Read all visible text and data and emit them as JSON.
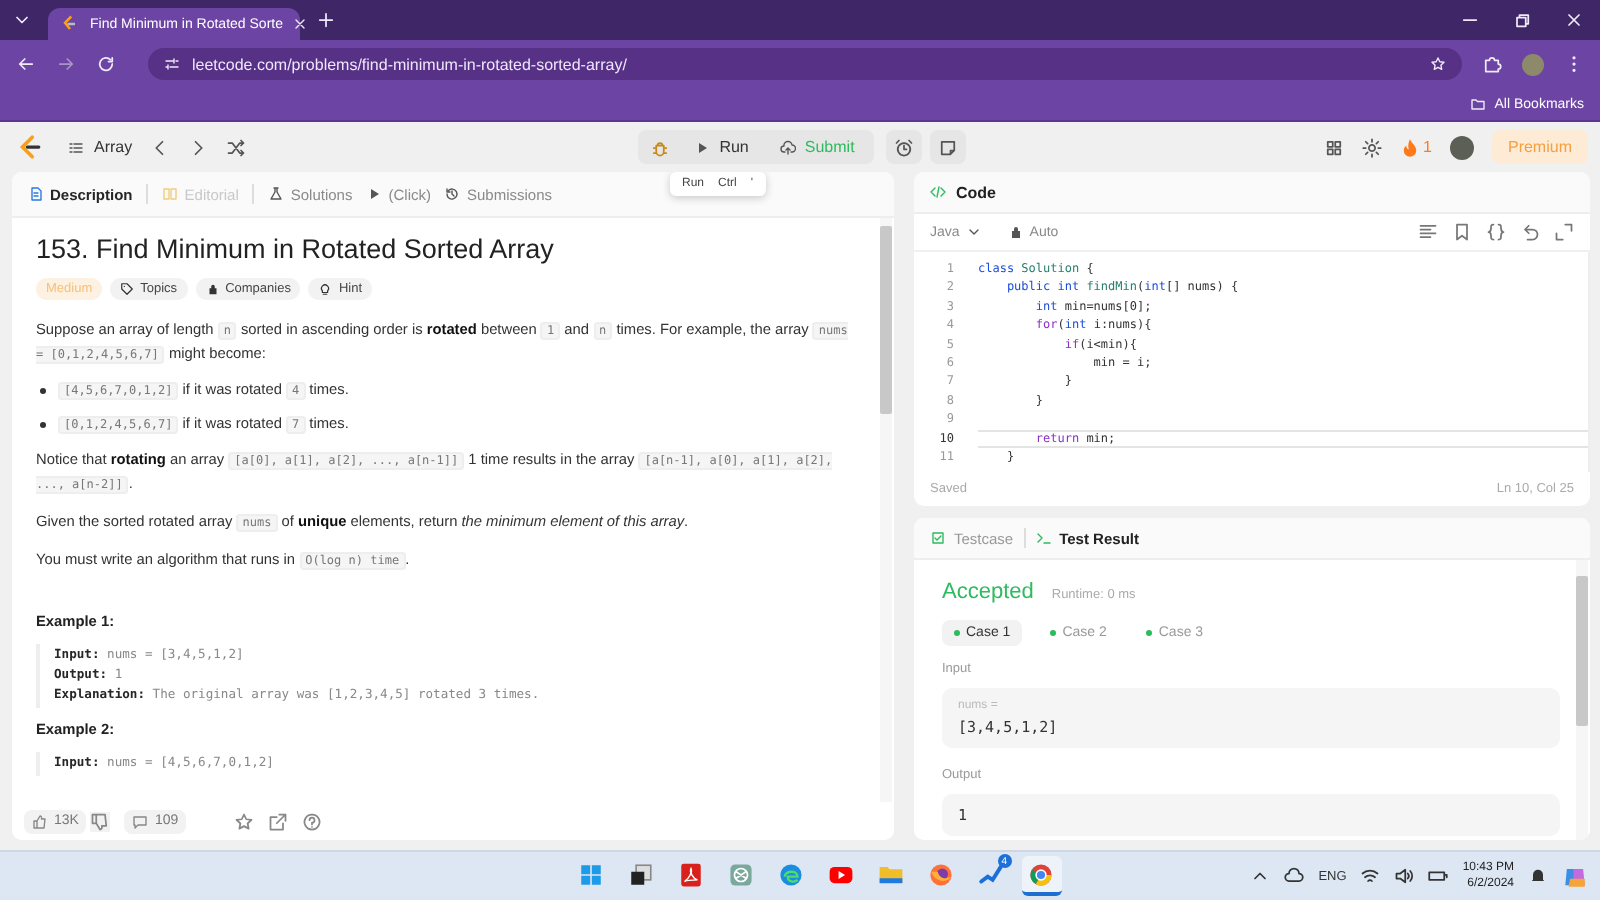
{
  "browser": {
    "tab_title": "Find Minimum in Rotated Sorte",
    "url": "leetcode.com/problems/find-minimum-in-rotated-sorted-array/",
    "bookmarks": "All Bookmarks"
  },
  "toolbar": {
    "problem_list": "Array",
    "run": "Run",
    "submit": "Submit",
    "streak": "1",
    "premium": "Premium"
  },
  "tooltip": {
    "label": "Run",
    "keys": [
      "Ctrl",
      "'"
    ]
  },
  "description_tabs": [
    {
      "label": "Description",
      "selected": true,
      "disabled": false
    },
    {
      "label": "Editorial",
      "selected": false,
      "disabled": true
    },
    {
      "label": "Solutions",
      "selected": false,
      "disabled": false
    },
    {
      "label": "(Click)",
      "selected": false,
      "disabled": false
    },
    {
      "label": "Submissions",
      "selected": false,
      "disabled": false
    }
  ],
  "problem": {
    "title": "153. Find Minimum in Rotated Sorted Array",
    "difficulty": "Medium",
    "tags": [
      "Topics",
      "Companies",
      "Hint"
    ],
    "blocks": [
      {
        "kind": "paragraph",
        "parts": [
          {
            "kind": "text",
            "text": "Suppose an array of length "
          },
          {
            "kind": "code",
            "text": "n"
          },
          {
            "kind": "text",
            "text": " sorted in ascending order is **rotated** between "
          },
          {
            "kind": "code",
            "text": "1"
          },
          {
            "kind": "text",
            "text": " and "
          },
          {
            "kind": "code",
            "text": "n"
          },
          {
            "kind": "text",
            "text": " times. For example, the array "
          },
          {
            "kind": "code",
            "text": "nums = [0,1,2,4,5,6,7]"
          },
          {
            "kind": "text",
            "text": " might become:"
          }
        ]
      },
      {
        "kind": "bullet",
        "parts": [
          {
            "kind": "code",
            "text": "[4,5,6,7,0,1,2]"
          },
          {
            "kind": "text",
            "text": " if it was rotated "
          },
          {
            "kind": "code",
            "text": "4"
          },
          {
            "kind": "text",
            "text": " times."
          }
        ]
      },
      {
        "kind": "bullet",
        "parts": [
          {
            "kind": "code",
            "text": "[0,1,2,4,5,6,7]"
          },
          {
            "kind": "text",
            "text": " if it was rotated "
          },
          {
            "kind": "code",
            "text": "7"
          },
          {
            "kind": "text",
            "text": " times."
          }
        ]
      },
      {
        "kind": "paragraph",
        "parts": [
          {
            "kind": "text",
            "text": "Notice that **rotating** an array "
          },
          {
            "kind": "code",
            "text": "[a[0], a[1], a[2], ..., a[n-1]]"
          },
          {
            "kind": "text",
            "text": " 1 time results in the array "
          },
          {
            "kind": "code",
            "text": "[a[n-1], a[0], a[1], a[2], ..., a[n-2]]"
          },
          {
            "kind": "text",
            "text": "."
          }
        ]
      },
      {
        "kind": "paragraph",
        "parts": [
          {
            "kind": "text",
            "text": "Given the sorted rotated array "
          },
          {
            "kind": "code",
            "text": "nums"
          },
          {
            "kind": "text",
            "text": " of **unique** elements, return *the minimum element of this array*."
          }
        ]
      },
      {
        "kind": "paragraph",
        "parts": [
          {
            "kind": "text",
            "text": "You must write an algorithm that runs in "
          },
          {
            "kind": "code",
            "text": "O(log n) time"
          },
          {
            "kind": "text",
            "text": "."
          }
        ]
      },
      {
        "kind": "heading",
        "text": "Example 1:"
      },
      {
        "kind": "example",
        "lines": [
          "**Input:** nums = [3,4,5,1,2]",
          "**Output:** 1",
          "**Explanation:** The original array was [1,2,3,4,5] rotated 3 times."
        ]
      },
      {
        "kind": "heading",
        "text": "Example 2:"
      },
      {
        "kind": "example",
        "lines": [
          "**Input:** nums = [4,5,6,7,0,1,2]"
        ]
      }
    ]
  },
  "footer": {
    "likes": "13K",
    "comments": "109"
  },
  "code": {
    "title": "Code",
    "language": "Java",
    "mode": "Auto",
    "status": "Saved",
    "cursor": "Ln 10, Col 25",
    "lines": [
      {
        "number": "1",
        "current": false,
        "tokens": [
          {
            "kind": "keyword",
            "text": "class"
          },
          {
            "kind": "name",
            "text": " Solution"
          },
          {
            "kind": "plain",
            "text": " {"
          }
        ]
      },
      {
        "number": "2",
        "current": false,
        "tokens": [
          {
            "kind": "keyword",
            "text": "    public int"
          },
          {
            "kind": "name",
            "text": " findMin"
          },
          {
            "kind": "plain",
            "text": "("
          },
          {
            "kind": "keyword",
            "text": "int"
          },
          {
            "kind": "plain",
            "text": "[] nums) {"
          }
        ]
      },
      {
        "number": "3",
        "current": false,
        "tokens": [
          {
            "kind": "keyword",
            "text": "        int"
          },
          {
            "kind": "plain",
            "text": " min=nums[0];"
          }
        ]
      },
      {
        "number": "4",
        "current": false,
        "tokens": [
          {
            "kind": "control",
            "text": "        for"
          },
          {
            "kind": "plain",
            "text": "("
          },
          {
            "kind": "keyword",
            "text": "int"
          },
          {
            "kind": "plain",
            "text": " i:nums){"
          }
        ]
      },
      {
        "number": "5",
        "current": false,
        "tokens": [
          {
            "kind": "control",
            "text": "            if"
          },
          {
            "kind": "plain",
            "text": "(i<min){"
          }
        ]
      },
      {
        "number": "6",
        "current": false,
        "tokens": [
          {
            "kind": "plain",
            "text": "                min = i;"
          }
        ]
      },
      {
        "number": "7",
        "current": false,
        "tokens": [
          {
            "kind": "plain",
            "text": "            }"
          }
        ]
      },
      {
        "number": "8",
        "current": false,
        "tokens": [
          {
            "kind": "plain",
            "text": "        }"
          }
        ]
      },
      {
        "number": "9",
        "current": false
      },
      {
        "number": "10",
        "current": true,
        "tokens": [
          {
            "kind": "control",
            "text": "        return"
          },
          {
            "kind": "plain",
            "text": " min;"
          }
        ]
      },
      {
        "number": "11",
        "current": false,
        "tokens": [
          {
            "kind": "plain",
            "text": "    }"
          }
        ]
      }
    ]
  },
  "tests": {
    "tabs": [
      {
        "label": "Testcase",
        "selected": false
      },
      {
        "label": "Test Result",
        "selected": true
      }
    ],
    "verdict": "Accepted",
    "runtime": "Runtime: 0 ms",
    "cases": [
      {
        "label": "Case 1",
        "selected": true,
        "passed": true
      },
      {
        "label": "Case 2",
        "selected": false,
        "passed": true
      },
      {
        "label": "Case 3",
        "selected": false,
        "passed": true
      }
    ],
    "input_label": "Input",
    "inputs": [
      {
        "name": "nums =",
        "value": "[3,4,5,1,2]"
      }
    ],
    "output_label": "Output",
    "output": "1"
  },
  "taskbar": {
    "apps": [
      {
        "kind": "start",
        "selected": false
      },
      {
        "kind": "taskview",
        "selected": false
      },
      {
        "kind": "pdf",
        "selected": false
      },
      {
        "kind": "assistant",
        "selected": false
      },
      {
        "kind": "wave-browser",
        "selected": false
      },
      {
        "kind": "video",
        "selected": false
      },
      {
        "kind": "files",
        "selected": false
      },
      {
        "kind": "fox-browser",
        "selected": false
      },
      {
        "kind": "games",
        "selected": false,
        "badge": "4"
      },
      {
        "kind": "ring-browser",
        "selected": true
      }
    ],
    "language": "ENG",
    "time": "10:43 PM",
    "date": "6/2/2024"
  }
}
